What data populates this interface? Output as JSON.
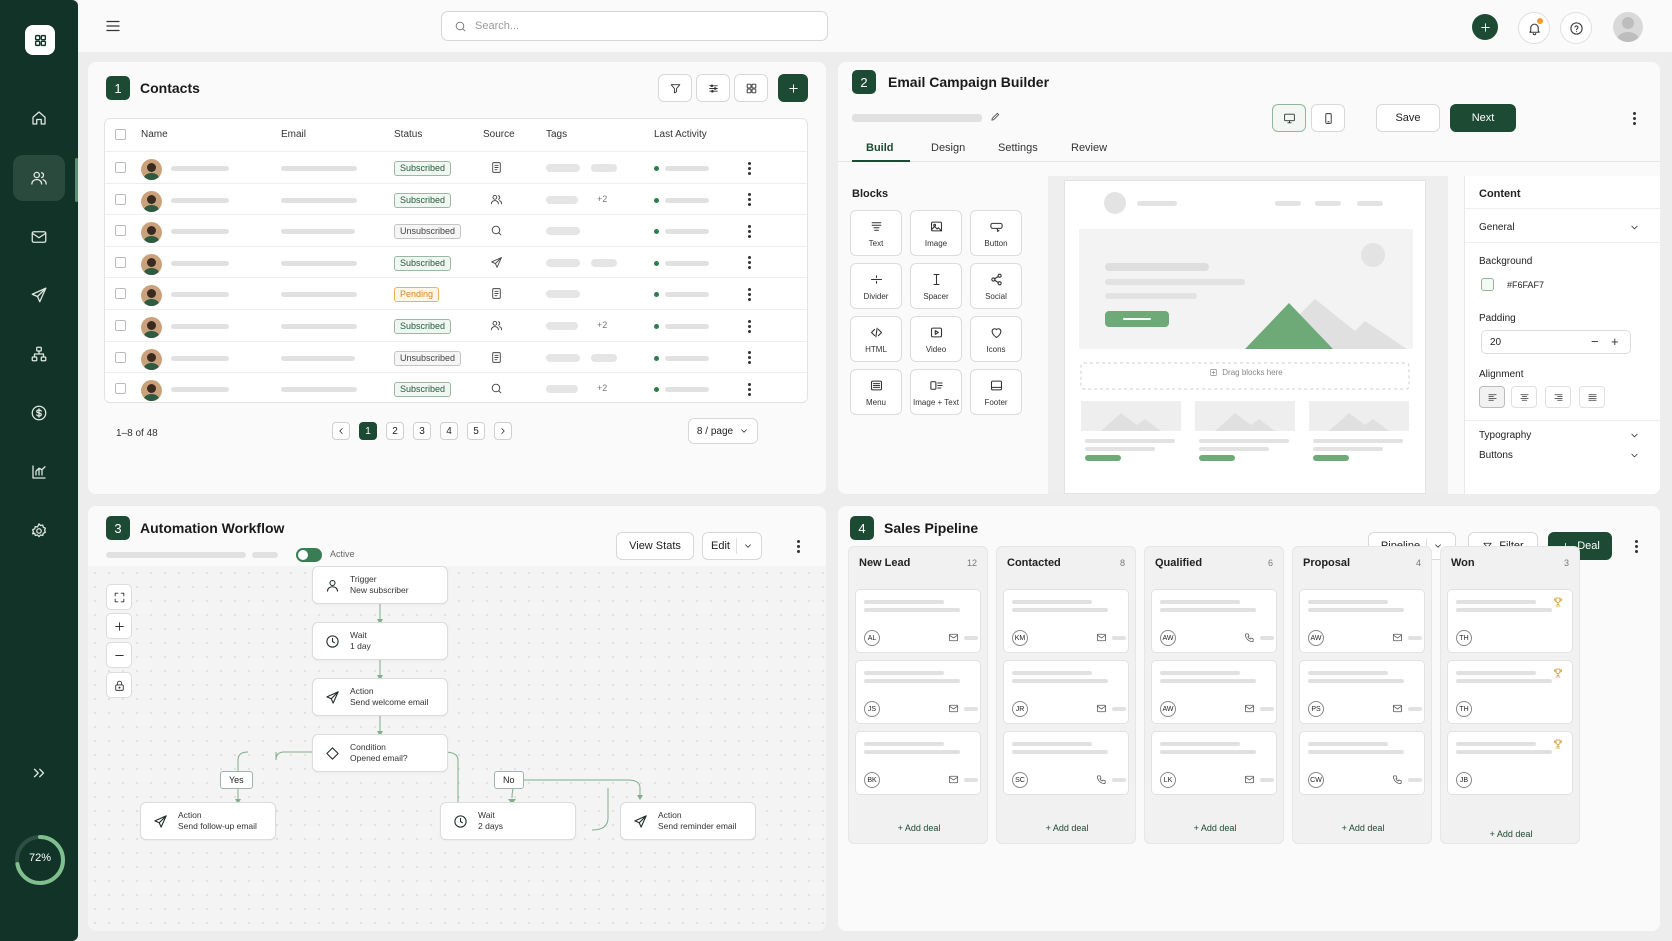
{
  "search": {
    "placeholder": "Search..."
  },
  "sidebar": {
    "progress_label": "72%",
    "progress": 0.72
  },
  "contacts": {
    "number": "1",
    "title": "Contacts",
    "columns": [
      "Name",
      "Email",
      "Status",
      "Source",
      "Tags",
      "Last Activity"
    ],
    "rows": [
      {
        "status": "Subscribed",
        "source_icon": "document-icon",
        "tag_more": ""
      },
      {
        "status": "Subscribed",
        "source_icon": "users-icon",
        "tag_more": "+2"
      },
      {
        "status": "Unsubscribed",
        "source_icon": "search-icon",
        "tag_more": ""
      },
      {
        "status": "Subscribed",
        "source_icon": "send-icon",
        "tag_more": ""
      },
      {
        "status": "Pending",
        "source_icon": "document-icon",
        "tag_more": ""
      },
      {
        "status": "Subscribed",
        "source_icon": "users-icon",
        "tag_more": "+2"
      },
      {
        "status": "Unsubscribed",
        "source_icon": "document-icon",
        "tag_more": ""
      },
      {
        "status": "Subscribed",
        "source_icon": "search-icon",
        "tag_more": "+2"
      }
    ],
    "range": "1–8 of 48",
    "pages": [
      "1",
      "2",
      "3",
      "4",
      "5"
    ],
    "per_page": "8 / page"
  },
  "builder": {
    "number": "2",
    "title": "Email Campaign Builder",
    "save": "Save",
    "next": "Next",
    "tabs": [
      "Build",
      "Design",
      "Settings",
      "Review"
    ],
    "blocks_title": "Blocks",
    "blocks": [
      "Text",
      "Image",
      "Button",
      "Divider",
      "Spacer",
      "Social",
      "HTML",
      "Video",
      "Icons",
      "Menu",
      "Image + Text",
      "Footer"
    ],
    "drag_hint": "Drag blocks here",
    "content_title": "Content",
    "general": "General",
    "background_label": "Background",
    "background_value": "#F6FAF7",
    "padding_label": "Padding",
    "padding_value": "20",
    "alignment_label": "Alignment",
    "typography": "Typography",
    "buttons": "Buttons"
  },
  "workflow": {
    "number": "3",
    "title": "Automation Workflow",
    "active": "Active",
    "view_stats": "View Stats",
    "edit": "Edit",
    "nodes": [
      {
        "label": "Trigger",
        "detail": "New subscriber"
      },
      {
        "label": "Wait",
        "detail": "1 day"
      },
      {
        "label": "Action",
        "detail": "Send welcome email"
      },
      {
        "label": "Condition",
        "detail": "Opened email?"
      },
      {
        "label": "Action",
        "detail": "Send follow-up email"
      },
      {
        "label": "Wait",
        "detail": "2 days"
      },
      {
        "label": "Action",
        "detail": "Send reminder email"
      }
    ],
    "yes": "Yes",
    "no": "No"
  },
  "pipeline": {
    "number": "4",
    "title": "Sales Pipeline",
    "view": "Pipeline",
    "filter": "Filter",
    "deal": "Deal",
    "add_deal": "+ Add deal",
    "columns": [
      {
        "name": "New Lead",
        "count": "12",
        "cards": [
          {
            "initials": "AL",
            "icon": "mail"
          },
          {
            "initials": "JS",
            "icon": "mail"
          },
          {
            "initials": "BK",
            "icon": "mail"
          }
        ]
      },
      {
        "name": "Contacted",
        "count": "8",
        "cards": [
          {
            "initials": "KM",
            "icon": "mail"
          },
          {
            "initials": "JR",
            "icon": "mail"
          },
          {
            "initials": "SC",
            "icon": "phone"
          }
        ]
      },
      {
        "name": "Qualified",
        "count": "6",
        "cards": [
          {
            "initials": "AW",
            "icon": "phone"
          },
          {
            "initials": "AW",
            "icon": "mail"
          },
          {
            "initials": "LK",
            "icon": "mail"
          }
        ]
      },
      {
        "name": "Proposal",
        "count": "4",
        "cards": [
          {
            "initials": "AW",
            "icon": "mail"
          },
          {
            "initials": "PS",
            "icon": "mail"
          },
          {
            "initials": "CW",
            "icon": "phone"
          }
        ]
      },
      {
        "name": "Won",
        "count": "3",
        "cards": [
          {
            "initials": "TH",
            "icon": "trophy"
          },
          {
            "initials": "TH",
            "icon": "trophy"
          },
          {
            "initials": "JB",
            "icon": "trophy"
          }
        ]
      }
    ]
  },
  "colors": {
    "brand": "#1D4A33",
    "sidebar": "#123327",
    "accent_green": "#6EAA78",
    "pending": "#F0A43A"
  }
}
